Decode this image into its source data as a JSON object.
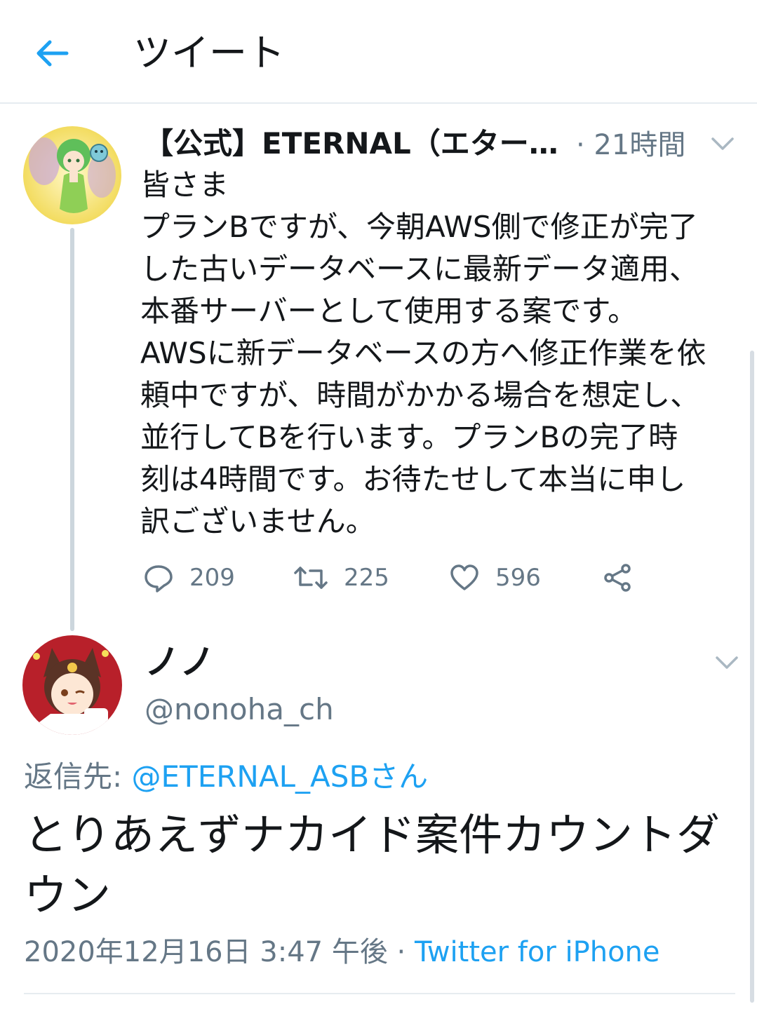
{
  "header": {
    "title": "ツイート"
  },
  "parent_tweet": {
    "display_name": "【公式】ETERNAL（エター…",
    "time": "· 21時間",
    "body": "皆さま\nプランBですが、今朝AWS側で修正が完了\nした古いデータベースに最新データ適用、\n本番サーバーとして使用する案です。\nAWSに新データベースの方へ修正作業を依\n頼中ですが、時間がかかる場合を想定し、\n並行してBを行います。プランBの完了時\n刻は4時間です。お待たせして本当に申し\n訳ございません。",
    "replies": "209",
    "retweets": "225",
    "likes": "596"
  },
  "reply_tweet": {
    "display_name": "ノノ",
    "handle": "@nonoha_ch",
    "reply_to_label": "返信先: ",
    "reply_to_mention": "@ETERNAL_ASBさん",
    "text": "とりあえずナカイド案件カウントダウン",
    "timestamp": "2020年12月16日 3:47 午後 · ",
    "source": "Twitter for iPhone"
  },
  "colors": {
    "accent": "#1da1f2",
    "secondary_text": "#657786",
    "divider": "#e6ecf0"
  },
  "icons": {
    "back": "arrow-left-icon",
    "reply": "comment-bubble-icon",
    "retweet": "retweet-arrows-icon",
    "like": "heart-outline-icon",
    "share": "share-nodes-icon",
    "menu": "chevron-down-icon"
  }
}
